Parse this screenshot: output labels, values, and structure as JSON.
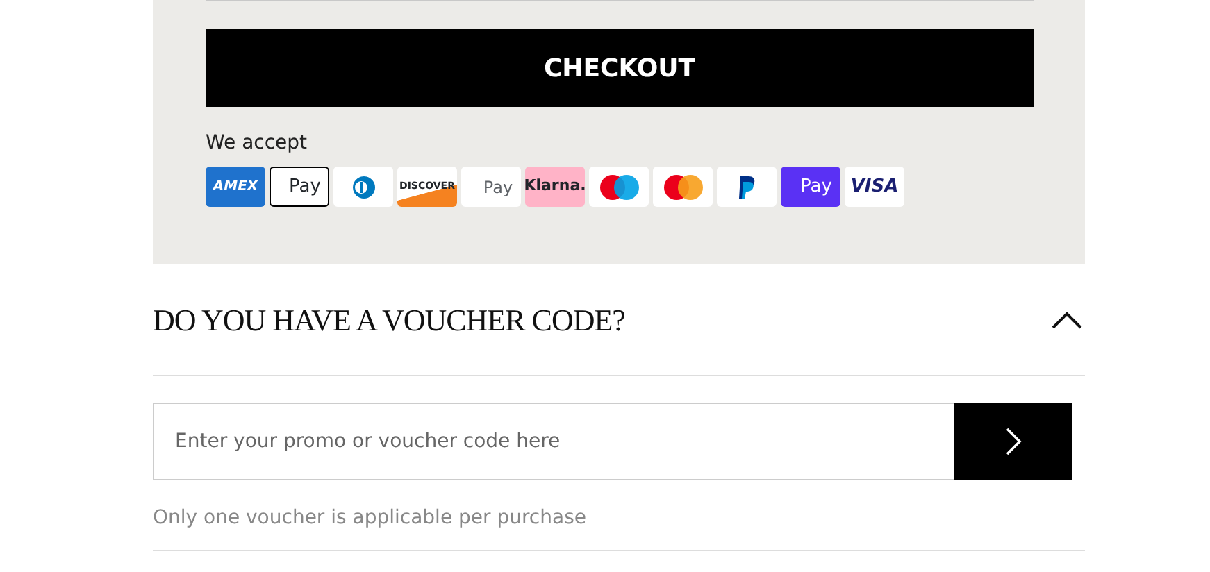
{
  "checkout": {
    "button": "CHECKOUT",
    "accept_label": "We accept",
    "payment_methods": [
      {
        "kind": "amex",
        "label": "AMEX"
      },
      {
        "kind": "applepay",
        "label": "Pay"
      },
      {
        "kind": "diners"
      },
      {
        "kind": "discover",
        "label": "DISCOVER"
      },
      {
        "kind": "googlepay",
        "label": "Pay"
      },
      {
        "kind": "klarna",
        "label": "Klarna."
      },
      {
        "kind": "maestro"
      },
      {
        "kind": "mastercard"
      },
      {
        "kind": "paypal"
      },
      {
        "kind": "opay",
        "label": "Pay"
      },
      {
        "kind": "visa",
        "label": "VISA"
      }
    ]
  },
  "voucher": {
    "title": "DO YOU HAVE A VOUCHER CODE?",
    "expanded": true,
    "placeholder": "Enter your promo or voucher code here",
    "note": "Only one voucher is applicable per purchase"
  }
}
